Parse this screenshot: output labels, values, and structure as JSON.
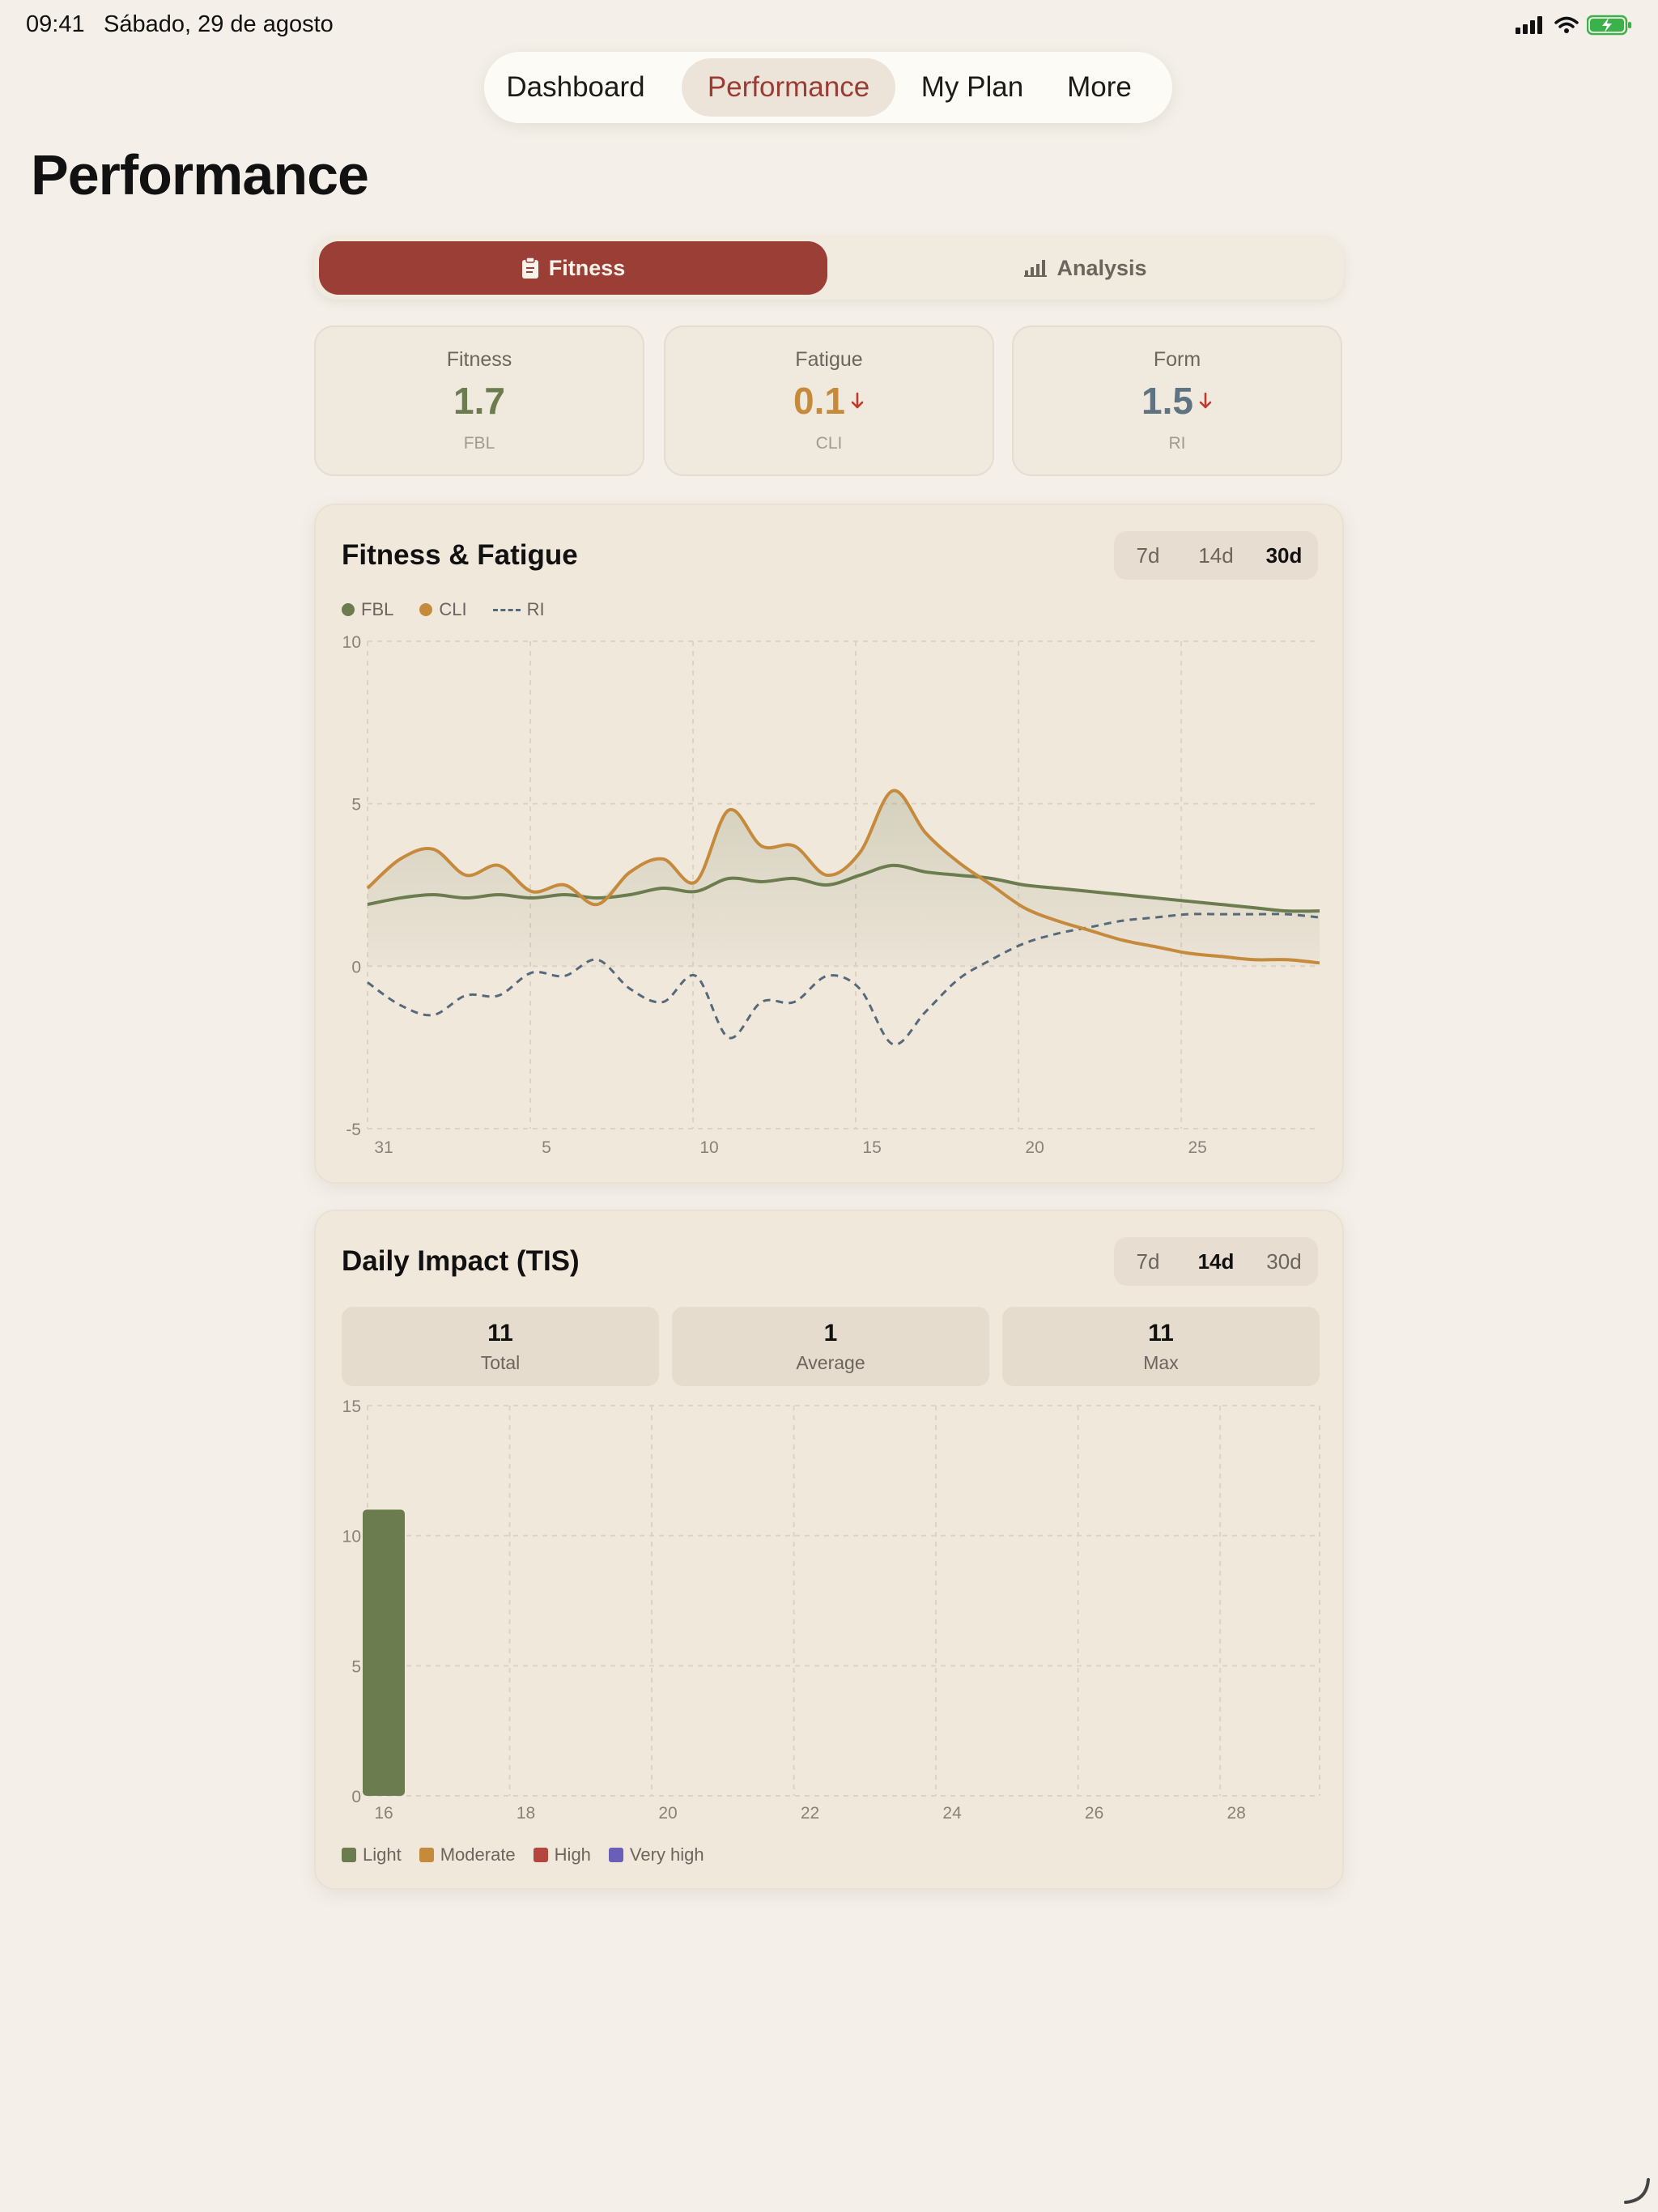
{
  "status_bar": {
    "time": "09:41",
    "date": "Sábado, 29 de agosto"
  },
  "nav": {
    "items": [
      "Dashboard",
      "Performance",
      "My Plan",
      "More"
    ],
    "active": "Performance"
  },
  "page_title": "Performance",
  "segmented": {
    "fitness_label": "Fitness",
    "analysis_label": "Analysis",
    "active": "Fitness"
  },
  "metrics": [
    {
      "label": "Fitness",
      "value": "1.7",
      "code": "FBL",
      "color": "#6b7d4e",
      "trend": ""
    },
    {
      "label": "Fatigue",
      "value": "0.1",
      "code": "CLI",
      "color": "#c68a3c",
      "trend": "down"
    },
    {
      "label": "Form",
      "value": "1.5",
      "code": "RI",
      "color": "#5f7382",
      "trend": "down"
    }
  ],
  "fitness_card": {
    "title": "Fitness & Fatigue",
    "ranges": [
      "7d",
      "14d",
      "30d"
    ],
    "selected_range": "30d",
    "legend": [
      "FBL",
      "CLI",
      "RI"
    ]
  },
  "impact_card": {
    "title": "Daily Impact (TIS)",
    "ranges": [
      "7d",
      "14d",
      "30d"
    ],
    "selected_range": "14d",
    "stats": [
      {
        "value": "11",
        "label": "Total"
      },
      {
        "value": "1",
        "label": "Average"
      },
      {
        "value": "11",
        "label": "Max"
      }
    ],
    "legend": [
      "Light",
      "Moderate",
      "High",
      "Very high"
    ]
  },
  "colors": {
    "accent": "#9a3e36",
    "fbl": "#6b7d4e",
    "cli": "#c68a3c",
    "ri": "#55697a",
    "light": "#6b7d4e",
    "moderate": "#c68a3c",
    "high": "#b5463d",
    "very_high": "#6a5fb8"
  },
  "chart_data": [
    {
      "type": "line",
      "title": "Fitness & Fatigue",
      "x_ticks": [
        "31",
        "5",
        "10",
        "15",
        "20",
        "25"
      ],
      "ylim": [
        -5,
        10
      ],
      "y_ticks": [
        -5,
        0,
        5,
        10
      ],
      "grid": true,
      "legend": "top-left",
      "x": [
        0,
        1,
        2,
        3,
        4,
        5,
        6,
        7,
        8,
        9,
        10,
        11,
        12,
        13,
        14,
        15,
        16,
        17,
        18,
        19,
        20,
        21,
        22,
        23,
        24,
        25,
        26,
        27,
        28,
        29
      ],
      "series": [
        {
          "name": "FBL",
          "values": [
            1.9,
            2.1,
            2.2,
            2.1,
            2.2,
            2.1,
            2.2,
            2.1,
            2.2,
            2.4,
            2.3,
            2.7,
            2.6,
            2.7,
            2.5,
            2.8,
            3.1,
            2.9,
            2.8,
            2.7,
            2.5,
            2.4,
            2.3,
            2.2,
            2.1,
            2.0,
            1.9,
            1.8,
            1.7,
            1.7
          ]
        },
        {
          "name": "CLI",
          "values": [
            2.4,
            3.3,
            3.6,
            2.8,
            3.1,
            2.3,
            2.5,
            1.9,
            2.9,
            3.3,
            2.6,
            4.8,
            3.7,
            3.7,
            2.8,
            3.5,
            5.4,
            4.1,
            3.2,
            2.5,
            1.8,
            1.4,
            1.1,
            0.8,
            0.6,
            0.4,
            0.3,
            0.2,
            0.2,
            0.1
          ]
        },
        {
          "name": "RI",
          "values": [
            -0.5,
            -1.2,
            -1.5,
            -0.9,
            -0.9,
            -0.2,
            -0.3,
            0.2,
            -0.7,
            -1.1,
            -0.3,
            -2.2,
            -1.1,
            -1.1,
            -0.3,
            -0.7,
            -2.4,
            -1.4,
            -0.4,
            0.2,
            0.7,
            1.0,
            1.2,
            1.4,
            1.5,
            1.6,
            1.6,
            1.6,
            1.6,
            1.5
          ]
        }
      ]
    },
    {
      "type": "bar",
      "title": "Daily Impact (TIS)",
      "x_ticks": [
        "16",
        "18",
        "20",
        "22",
        "24",
        "26",
        "28"
      ],
      "x": [
        16,
        17,
        18,
        19,
        20,
        21,
        22,
        23,
        24,
        25,
        26,
        27,
        28,
        29
      ],
      "ylim": [
        0,
        15
      ],
      "y_ticks": [
        0,
        5,
        10,
        15
      ],
      "grid": true,
      "legend": "bottom-left",
      "series": [
        {
          "name": "Light",
          "values": [
            11,
            0,
            0,
            0,
            0,
            0,
            0,
            0,
            0,
            0,
            0,
            0,
            0,
            0
          ]
        }
      ]
    }
  ]
}
